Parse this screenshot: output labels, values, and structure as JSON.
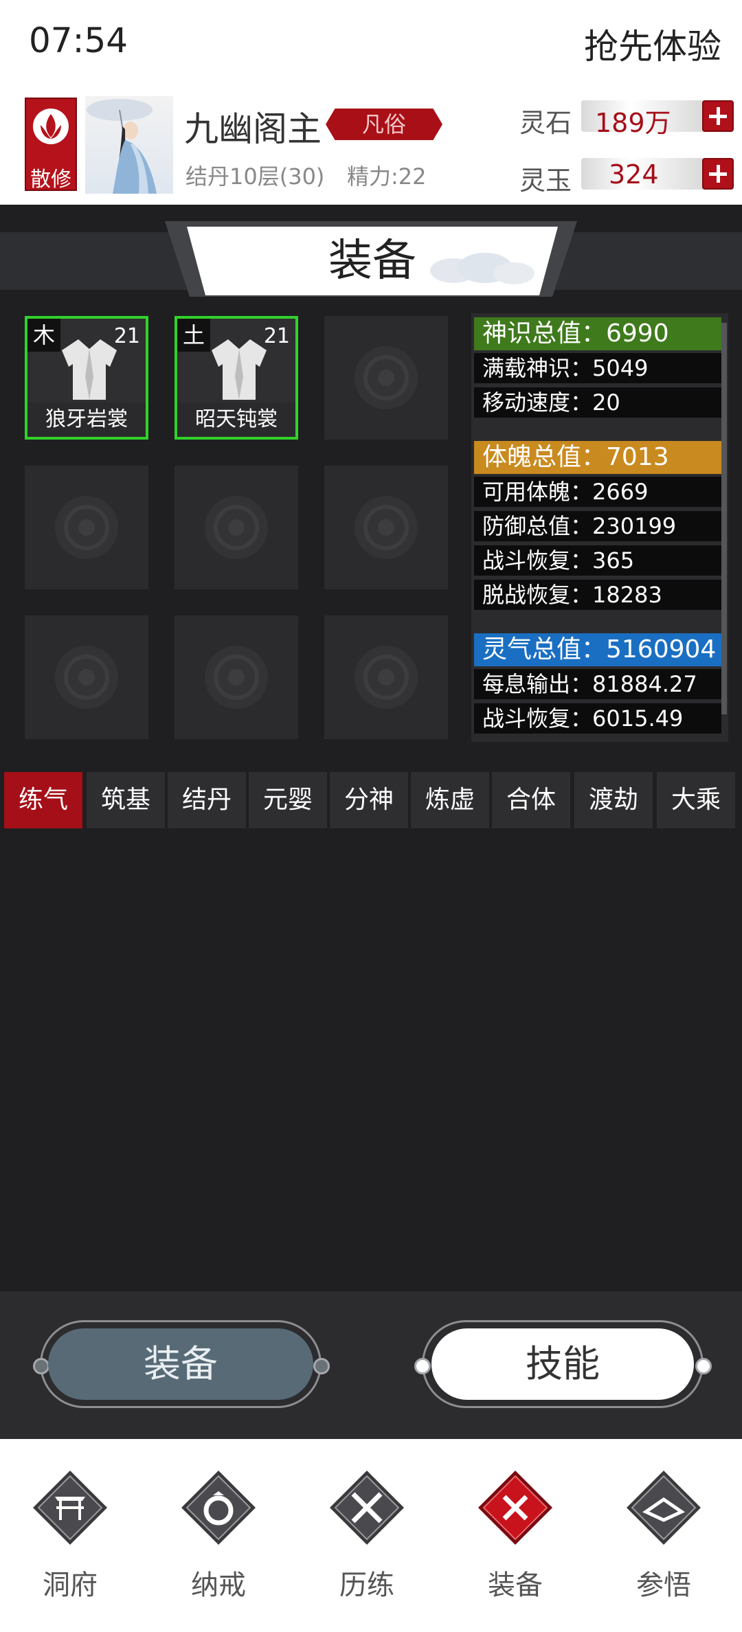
{
  "status_bar": {
    "time": "07:54",
    "experience_label": "抢先体验"
  },
  "profile": {
    "sect": "散修",
    "name": "九幽阁主",
    "rank": "凡俗",
    "realm_level": "结丹10层(30)",
    "energy": "精力:22",
    "currencies": [
      {
        "label": "灵石",
        "value": "189万"
      },
      {
        "label": "灵玉",
        "value": "324"
      }
    ]
  },
  "section_title": "装备",
  "equipment": {
    "slots": [
      {
        "element": "木",
        "level": "21",
        "name": "狼牙岩裳"
      },
      {
        "element": "土",
        "level": "21",
        "name": "昭天钝裳"
      }
    ]
  },
  "stats": {
    "groups": [
      {
        "header": "神识总值：6990",
        "color": "#3f7a1c",
        "rows": [
          "满载神识：5049",
          "移动速度：20"
        ]
      },
      {
        "header": "体魄总值：7013",
        "color": "#c98a1f",
        "rows": [
          "可用体魄：2669",
          "防御总值：230199",
          "战斗恢复：365",
          "脱战恢复：18283"
        ]
      },
      {
        "header": "灵气总值：5160904",
        "color": "#1a6fc2",
        "rows": [
          "每息输出：81884.27",
          "战斗恢复：6015.49"
        ]
      }
    ]
  },
  "realm_tabs": [
    "练气",
    "筑基",
    "结丹",
    "元婴",
    "分神",
    "炼虚",
    "合体",
    "渡劫",
    "大乘"
  ],
  "actions": {
    "equip": "装备",
    "skills": "技能"
  },
  "nav": [
    "洞府",
    "纳戒",
    "历练",
    "装备",
    "参悟"
  ],
  "colors": {
    "accent_red": "#a50f18",
    "equipped_border": "#31d12b"
  }
}
